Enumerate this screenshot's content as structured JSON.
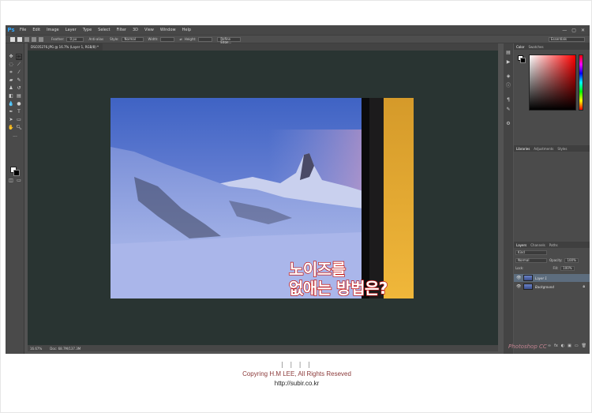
{
  "app": {
    "logo": "Ps",
    "menu": [
      "File",
      "Edit",
      "Image",
      "Layer",
      "Type",
      "Select",
      "Filter",
      "3D",
      "View",
      "Window",
      "Help"
    ],
    "window_controls": [
      "—",
      "▢",
      "✕"
    ]
  },
  "options_bar": {
    "feather_label": "Feather:",
    "feather_value": "0 px",
    "antialias_label": "Anti-alias",
    "style_label": "Style:",
    "style_value": "Normal",
    "width_label": "Width:",
    "height_label": "Height:",
    "refine_label": "Refine Edge...",
    "workspace_value": "Essentials"
  },
  "document": {
    "tab_title": "DSC05276.JPG @ 16.7% (Layer 1, RGB/8) *",
    "overlay_line1": "노이즈를",
    "overlay_line2": "없애는 방법은?"
  },
  "status_bar": {
    "zoom": "16.67%",
    "doc_size": "Doc: 68.7M/137.3M"
  },
  "color_panel": {
    "tabs": [
      "Color",
      "Swatches"
    ]
  },
  "libraries_panel": {
    "tabs": [
      "Libraries",
      "Adjustments",
      "Styles"
    ]
  },
  "layers_panel": {
    "tabs": [
      "Layers",
      "Channels",
      "Paths"
    ],
    "kind_label": "Kind",
    "blend_mode": "Normal",
    "opacity_label": "Opacity:",
    "opacity_value": "100%",
    "lock_label": "Lock:",
    "fill_label": "Fill:",
    "fill_value": "100%",
    "layers": [
      {
        "name": "Layer 1"
      },
      {
        "name": "Background"
      }
    ],
    "footer_icons": [
      "∞",
      "fx",
      "◐",
      "▣",
      "▭",
      "🗑"
    ]
  },
  "watermark": "Photoshop CC",
  "caption": {
    "bars": "| | | |",
    "copyright": "Copyring H.M LEE, All Rights Reseved",
    "url": "http://subir.co.kr"
  },
  "colors": {
    "brand": "#31a8ff",
    "overlay_stroke": "#c21010",
    "caption_red": "#8b3a3a"
  }
}
